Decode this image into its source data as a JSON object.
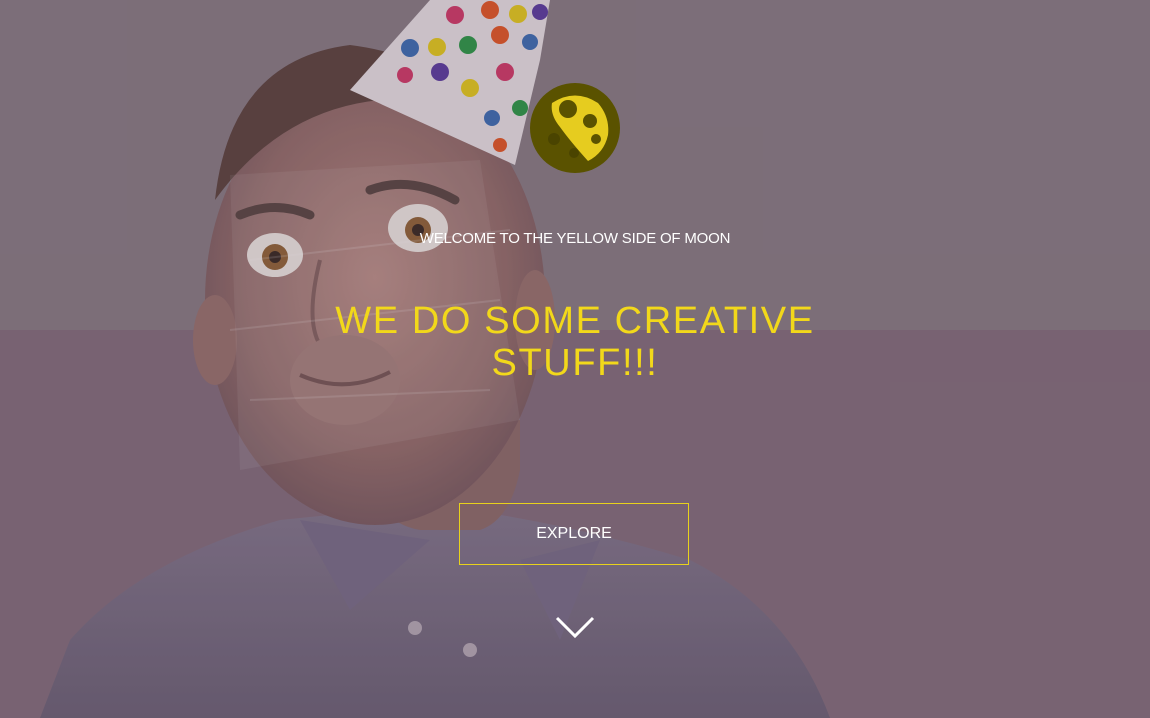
{
  "hero": {
    "tagline": "WELCOME TO THE YELLOW SIDE OF MOON",
    "headline": "WE DO SOME CREATIVE STUFF!!!",
    "explore_label": "EXPLORE"
  },
  "colors": {
    "accent": "#f2d81a",
    "logo_dark": "#5a5200",
    "logo_yellow": "#e6cc1f",
    "text": "#ffffff"
  },
  "icons": {
    "logo": "moon-logo-icon",
    "scroll": "chevron-down-icon"
  }
}
